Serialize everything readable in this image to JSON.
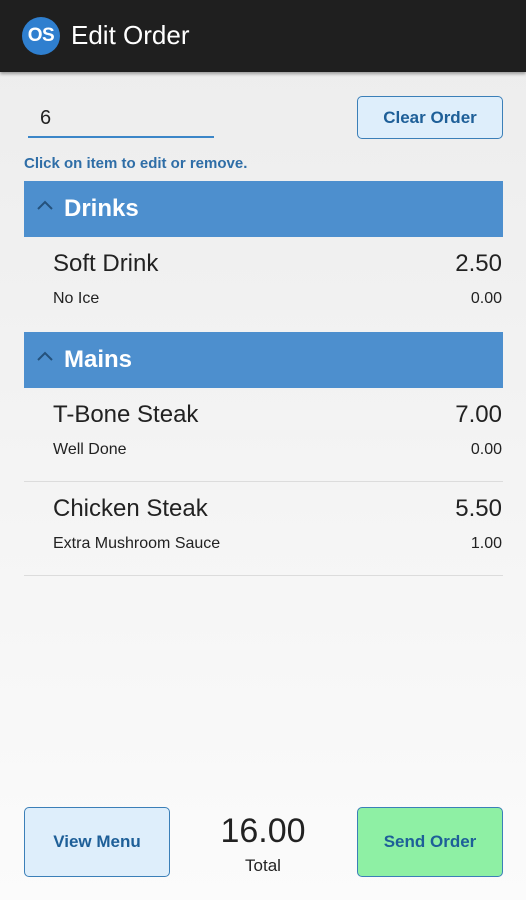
{
  "appbar": {
    "logo_text": "OS",
    "title": "Edit Order"
  },
  "table_number": {
    "value": "6"
  },
  "clear_button": {
    "label": "Clear Order"
  },
  "hint": "Click on item to edit or remove.",
  "categories": [
    {
      "title": "Drinks",
      "items": [
        {
          "name": "Soft Drink",
          "price": "2.50",
          "modifier": "No Ice",
          "modifier_price": "0.00"
        }
      ]
    },
    {
      "title": "Mains",
      "items": [
        {
          "name": "T-Bone Steak",
          "price": "7.00",
          "modifier": "Well Done",
          "modifier_price": "0.00"
        },
        {
          "name": "Chicken Steak",
          "price": "5.50",
          "modifier": "Extra Mushroom Sauce",
          "modifier_price": "1.00"
        }
      ]
    }
  ],
  "footer": {
    "view_menu_label": "View Menu",
    "total_value": "16.00",
    "total_label": "Total",
    "send_label": "Send Order"
  },
  "colors": {
    "appbar": "#1f1f1f",
    "accent": "#4d8fce",
    "button_bg": "#deeefb",
    "send_bg": "#8ef0a4",
    "button_text": "#1e5f98"
  }
}
